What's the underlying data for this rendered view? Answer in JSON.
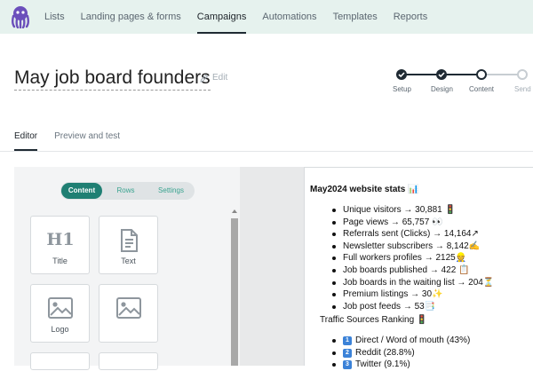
{
  "nav": {
    "items": [
      {
        "label": "Lists",
        "active": false
      },
      {
        "label": "Landing pages & forms",
        "active": false
      },
      {
        "label": "Campaigns",
        "active": true
      },
      {
        "label": "Automations",
        "active": false
      },
      {
        "label": "Templates",
        "active": false
      },
      {
        "label": "Reports",
        "active": false
      }
    ]
  },
  "campaign": {
    "title": "May job board founders",
    "edit_label": "Edit"
  },
  "steps": [
    {
      "label": "Setup",
      "state": "done"
    },
    {
      "label": "Design",
      "state": "done"
    },
    {
      "label": "Content",
      "state": "current"
    },
    {
      "label": "Send",
      "state": "pending"
    }
  ],
  "tabs": [
    {
      "label": "Editor",
      "active": true
    },
    {
      "label": "Preview and test",
      "active": false
    }
  ],
  "editor": {
    "segments": [
      {
        "label": "Content",
        "active": true
      },
      {
        "label": "Rows",
        "active": false
      },
      {
        "label": "Settings",
        "active": false
      }
    ],
    "blocks": [
      {
        "label": "Title",
        "icon": "h1-icon"
      },
      {
        "label": "Text",
        "icon": "document-icon"
      },
      {
        "label": "Logo",
        "icon": "image-icon"
      },
      {
        "label": "Image",
        "icon": "image-icon"
      }
    ]
  },
  "preview": {
    "heading": "May2024 website stats 📊",
    "stats": [
      "Unique visitors → 30,881 🚦",
      "Page views →  65,757 👀",
      "Referrals sent (Clicks) → 14,164↗",
      "Newsletter subscribers → 8,142✍",
      "Full workers profiles → 2125👷",
      "Job boards published → 422 📋",
      "Job boards in the waiting list → 204⏳",
      "Premium listings → 30✨",
      "Job post feeds → 53📑"
    ],
    "traffic_heading": "Traffic Sources Ranking 🚦",
    "traffic": [
      {
        "rank": "1",
        "label": "Direct / Word of mouth (43%)"
      },
      {
        "rank": "2",
        "label": "Reddit (28.8%)"
      },
      {
        "rank": "3",
        "label": "Twitter (9.1%)"
      }
    ]
  },
  "colors": {
    "nav_bg": "#e6f2ee",
    "accent": "#1f7f73",
    "dark": "#1f2a33"
  }
}
